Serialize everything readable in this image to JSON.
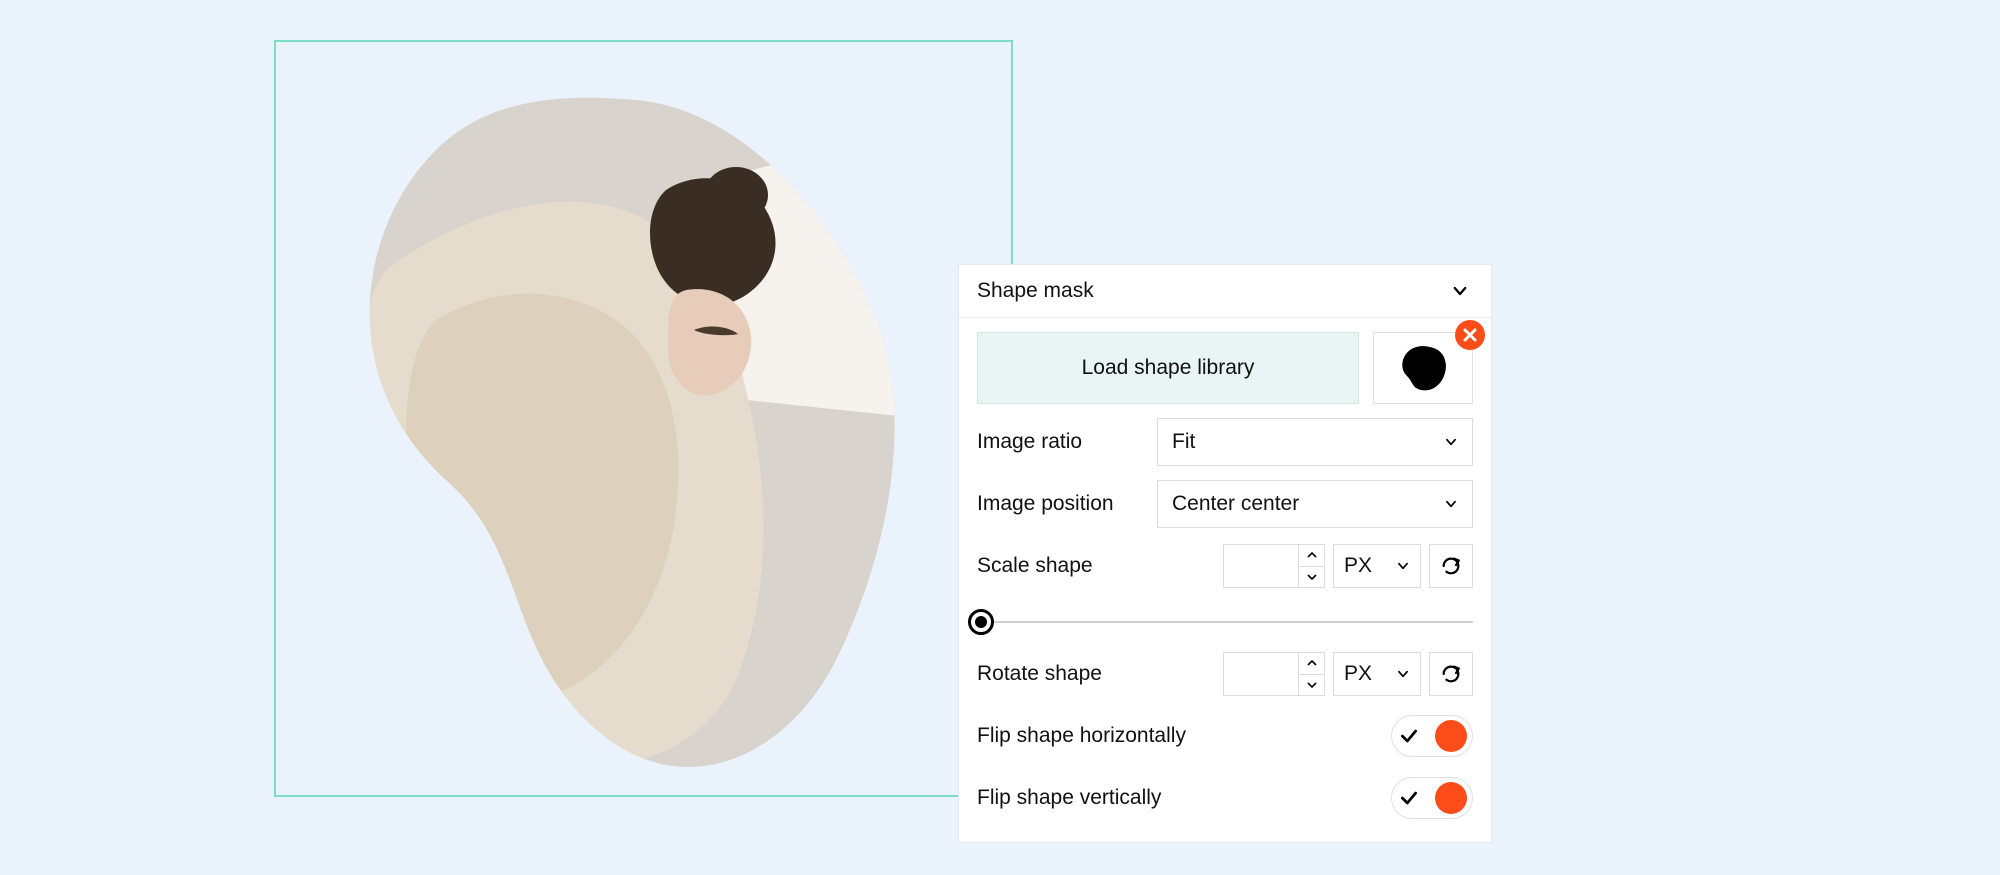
{
  "panel": {
    "title": "Shape mask",
    "load_button": "Load shape library",
    "image_ratio": {
      "label": "Image ratio",
      "value": "Fit"
    },
    "image_position": {
      "label": "Image position",
      "value": "Center center"
    },
    "scale": {
      "label": "Scale shape",
      "value": "",
      "unit": "PX"
    },
    "rotate": {
      "label": "Rotate shape",
      "value": "",
      "unit": "PX"
    },
    "flip_h": {
      "label": "Flip shape horizontally",
      "value": true
    },
    "flip_v": {
      "label": "Flip shape vertically",
      "value": true
    }
  }
}
